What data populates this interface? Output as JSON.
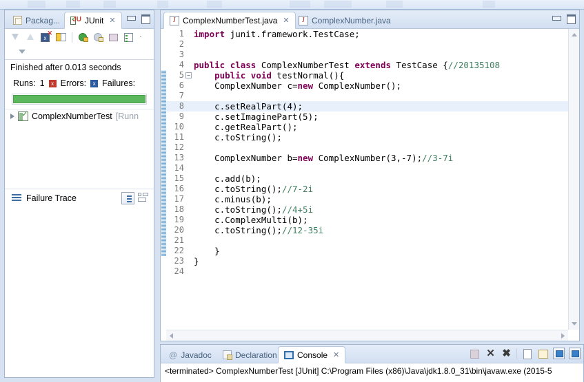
{
  "window": {
    "background": "#d6e2f2"
  },
  "junit_view": {
    "tabs": [
      {
        "label": "Packag...",
        "icon": "package-explorer-icon",
        "active": false
      },
      {
        "label": "JUnit",
        "icon": "junit-icon",
        "active": true,
        "close": "✕"
      }
    ],
    "toolbar": [
      {
        "name": "next-failure-icon",
        "label": ""
      },
      {
        "name": "previous-failure-icon",
        "label": ""
      },
      {
        "name": "show-failures-only-icon",
        "label": ""
      },
      {
        "name": "scroll-lock-icon",
        "label": ""
      },
      {
        "name": "rerun-test-icon",
        "label": ""
      },
      {
        "name": "rerun-failed-tests-icon",
        "label": ""
      },
      {
        "name": "stop-test-icon",
        "label": ""
      },
      {
        "name": "test-run-history-icon",
        "label": ""
      }
    ],
    "status_text": "Finished after 0.013 seconds",
    "counts": {
      "runs_label": "Runs:",
      "runs_value": "1",
      "errors_label": "Errors:",
      "errors_badge": "x",
      "failures_label": "Failures:",
      "failures_badge": "x"
    },
    "progress": {
      "percent": 100,
      "color": "#5cb85c"
    },
    "tree": [
      {
        "label": "ComplexNumberTest",
        "suffix": "[Runn",
        "icon": "test-class-icon"
      }
    ],
    "failure_trace": {
      "title": "Failure Trace",
      "tools": [
        {
          "name": "compare-result-button"
        },
        {
          "name": "view-menu-button"
        }
      ]
    }
  },
  "editor": {
    "tabs": [
      {
        "label": "ComplexNumberTest.java",
        "active": true,
        "close": "✕"
      },
      {
        "label": "ComplexNumber.java",
        "active": false
      }
    ],
    "view_buttons": [
      {
        "name": "minimize-button"
      },
      {
        "name": "maximize-button"
      }
    ],
    "highlight_line": 8,
    "lines": [
      {
        "n": "1",
        "fold": "",
        "segments": [
          {
            "t": "import",
            "c": "kw"
          },
          {
            "t": " junit.framework.TestCase;",
            "c": ""
          }
        ]
      },
      {
        "n": "2",
        "fold": "",
        "segments": []
      },
      {
        "n": "3",
        "fold": "",
        "segments": []
      },
      {
        "n": "4",
        "fold": "",
        "segments": [
          {
            "t": "public",
            "c": "kw"
          },
          {
            "t": " ",
            "c": ""
          },
          {
            "t": "class",
            "c": "kw"
          },
          {
            "t": " ComplexNumberTest ",
            "c": ""
          },
          {
            "t": "extends",
            "c": "kw"
          },
          {
            "t": " TestCase {",
            "c": ""
          },
          {
            "t": "//20135108",
            "c": "cm"
          }
        ]
      },
      {
        "n": "5",
        "fold": "⊖",
        "segments": [
          {
            "t": "    ",
            "c": ""
          },
          {
            "t": "public",
            "c": "kw"
          },
          {
            "t": " ",
            "c": ""
          },
          {
            "t": "void",
            "c": "kw"
          },
          {
            "t": " testNormal(){",
            "c": ""
          }
        ]
      },
      {
        "n": "6",
        "fold": "",
        "segments": [
          {
            "t": "    ComplexNumber c=",
            "c": ""
          },
          {
            "t": "new",
            "c": "kw"
          },
          {
            "t": " ComplexNumber();",
            "c": ""
          }
        ]
      },
      {
        "n": "7",
        "fold": "",
        "segments": []
      },
      {
        "n": "8",
        "fold": "",
        "segments": [
          {
            "t": "    c.setRealPart(4);",
            "c": ""
          }
        ]
      },
      {
        "n": "9",
        "fold": "",
        "segments": [
          {
            "t": "    c.setImaginePart(5);",
            "c": ""
          }
        ]
      },
      {
        "n": "10",
        "fold": "",
        "segments": [
          {
            "t": "    c.getRealPart();",
            "c": ""
          }
        ]
      },
      {
        "n": "11",
        "fold": "",
        "segments": [
          {
            "t": "    c.toString();",
            "c": ""
          }
        ]
      },
      {
        "n": "12",
        "fold": "",
        "segments": []
      },
      {
        "n": "13",
        "fold": "",
        "segments": [
          {
            "t": "    ComplexNumber b=",
            "c": ""
          },
          {
            "t": "new",
            "c": "kw"
          },
          {
            "t": " ComplexNumber(3,-7);",
            "c": ""
          },
          {
            "t": "//3-7i",
            "c": "cm"
          }
        ]
      },
      {
        "n": "14",
        "fold": "",
        "segments": []
      },
      {
        "n": "15",
        "fold": "",
        "segments": [
          {
            "t": "    c.add(b);",
            "c": ""
          }
        ]
      },
      {
        "n": "16",
        "fold": "",
        "segments": [
          {
            "t": "    c.toString();",
            "c": ""
          },
          {
            "t": "//7-2i",
            "c": "cm"
          }
        ]
      },
      {
        "n": "17",
        "fold": "",
        "segments": [
          {
            "t": "    c.minus(b);",
            "c": ""
          }
        ]
      },
      {
        "n": "18",
        "fold": "",
        "segments": [
          {
            "t": "    c.toString();",
            "c": ""
          },
          {
            "t": "//4+5i",
            "c": "cm"
          }
        ]
      },
      {
        "n": "19",
        "fold": "",
        "segments": [
          {
            "t": "    c.ComplexMulti(b);",
            "c": ""
          }
        ]
      },
      {
        "n": "20",
        "fold": "",
        "segments": [
          {
            "t": "    c.toString();",
            "c": ""
          },
          {
            "t": "//12-35i",
            "c": "cm"
          }
        ]
      },
      {
        "n": "21",
        "fold": "",
        "segments": []
      },
      {
        "n": "22",
        "fold": "",
        "segments": [
          {
            "t": "    }",
            "c": ""
          }
        ]
      },
      {
        "n": "23",
        "fold": "",
        "segments": [
          {
            "t": "}",
            "c": ""
          }
        ]
      },
      {
        "n": "24",
        "fold": "",
        "segments": []
      }
    ]
  },
  "console": {
    "tabs": [
      {
        "label": "Javadoc",
        "icon": "javadoc-icon",
        "active": false
      },
      {
        "label": "Declaration",
        "icon": "declaration-icon",
        "active": false
      },
      {
        "label": "Console",
        "icon": "console-icon",
        "active": true,
        "close": "✕"
      }
    ],
    "toolbar": [
      {
        "name": "terminate-button"
      },
      {
        "name": "remove-launch-button"
      },
      {
        "name": "remove-all-terminated-button"
      },
      {
        "name": "open-console-button"
      },
      {
        "name": "scroll-lock-button"
      },
      {
        "name": "display-selected-console-button"
      },
      {
        "name": "pin-console-button"
      }
    ],
    "output": "<terminated> ComplexNumberTest [JUnit] C:\\Program Files (x86)\\Java\\jdk1.8.0_31\\bin\\javaw.exe (2015-5"
  }
}
